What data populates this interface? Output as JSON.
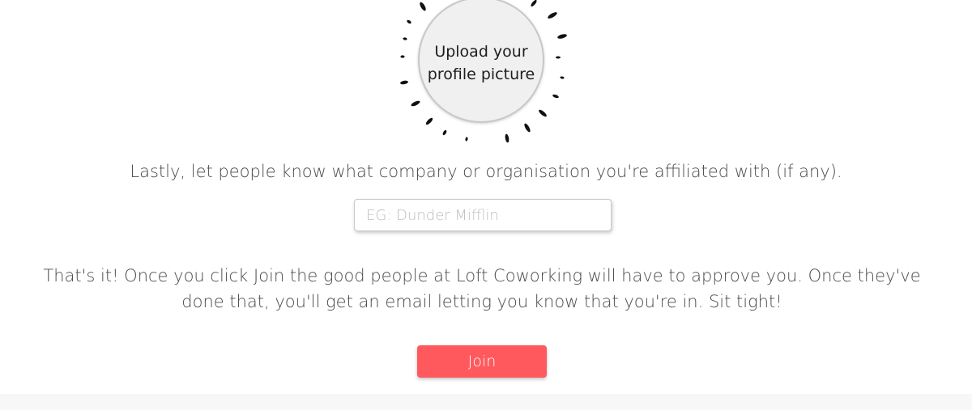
{
  "upload": {
    "label": "Upload your\nprofile picture",
    "icon": "sunburst-rays-icon"
  },
  "affiliation": {
    "prompt": "Lastly, let people know what company or organisation you're affiliated with (if any).",
    "placeholder": "EG: Dunder Mifflin",
    "value": ""
  },
  "info": {
    "text": "That's it! Once you click Join the good people at Loft Coworking will have to approve you. Once they've done that, you'll get an email letting you know that you're in. Sit tight!"
  },
  "actions": {
    "join_label": "Join",
    "join_color": "#ff595e"
  }
}
